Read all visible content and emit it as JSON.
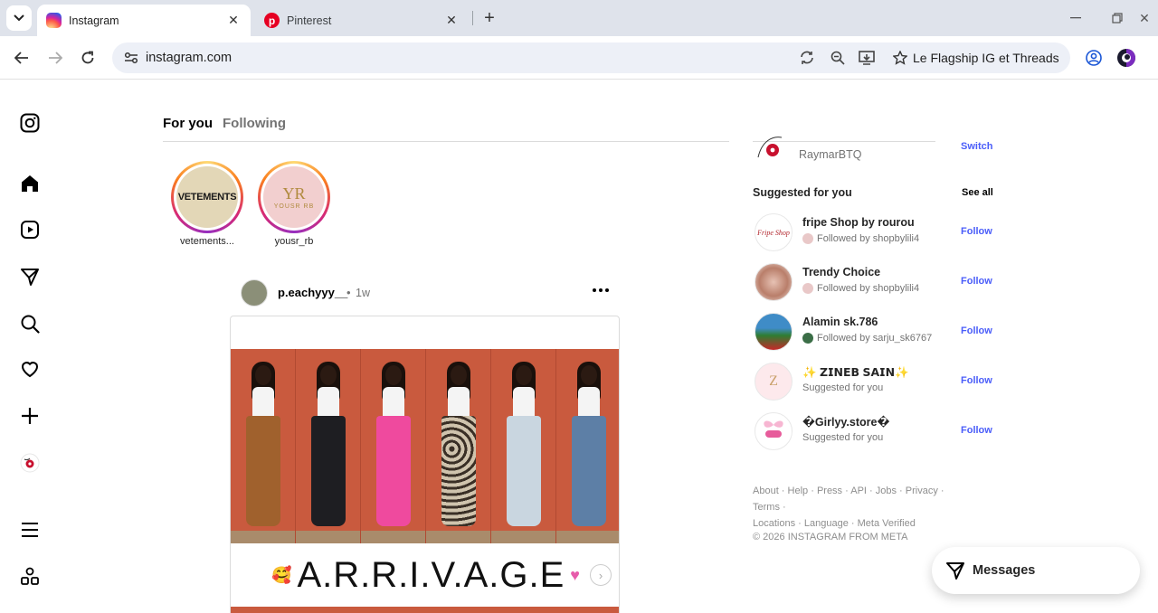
{
  "browser": {
    "tabs": [
      {
        "title": "Instagram",
        "active": true
      },
      {
        "title": "Pinterest",
        "active": false
      }
    ],
    "url": "instagram.com",
    "bookmark_label": "Le Flagship IG et Threads"
  },
  "feed": {
    "tabs": [
      "For you",
      "Following"
    ],
    "stories": [
      {
        "name": "vetements...",
        "logo_text": "VETEMENTS"
      },
      {
        "name": "yousr_rb",
        "logo_text": "YOUSR RB"
      }
    ],
    "post": {
      "username": "p.eachyyy__",
      "separator": "•",
      "time": "1w",
      "banner_text": "A.R.R.I.V.A.G.E"
    }
  },
  "sidebar": {
    "current_user_handle": "RaymarBTQ",
    "switch_label": "Switch",
    "suggested_title": "Suggested for you",
    "see_all": "See all",
    "suggestions": [
      {
        "name": "fripe Shop by rourou",
        "subtitle": "Followed by shopbylili4",
        "action": "Follow"
      },
      {
        "name": "Trendy Choice",
        "subtitle": "Followed by shopbylili4",
        "action": "Follow"
      },
      {
        "name": "Alamin sk.786",
        "subtitle": "Followed by sarju_sk6767",
        "action": "Follow"
      },
      {
        "name": "✨ 𝗭𝗜𝗡𝗘𝗕 𝗦𝗔𝗜𝗡✨",
        "subtitle": "Suggested for you",
        "action": "Follow"
      },
      {
        "name": "�Girlyy.store�",
        "subtitle": "Suggested for you",
        "action": "Follow"
      }
    ],
    "footer_links": [
      "About",
      "Help",
      "Press",
      "API",
      "Jobs",
      "Privacy",
      "Terms",
      "Locations",
      "Language",
      "Meta Verified"
    ],
    "copyright": "© 2026 INSTAGRAM FROM META"
  },
  "messages_label": "Messages",
  "colors": {
    "link_blue": "#4a5df9",
    "tab_bar": "#dfe3eb",
    "omnibox": "#edf0f7"
  }
}
